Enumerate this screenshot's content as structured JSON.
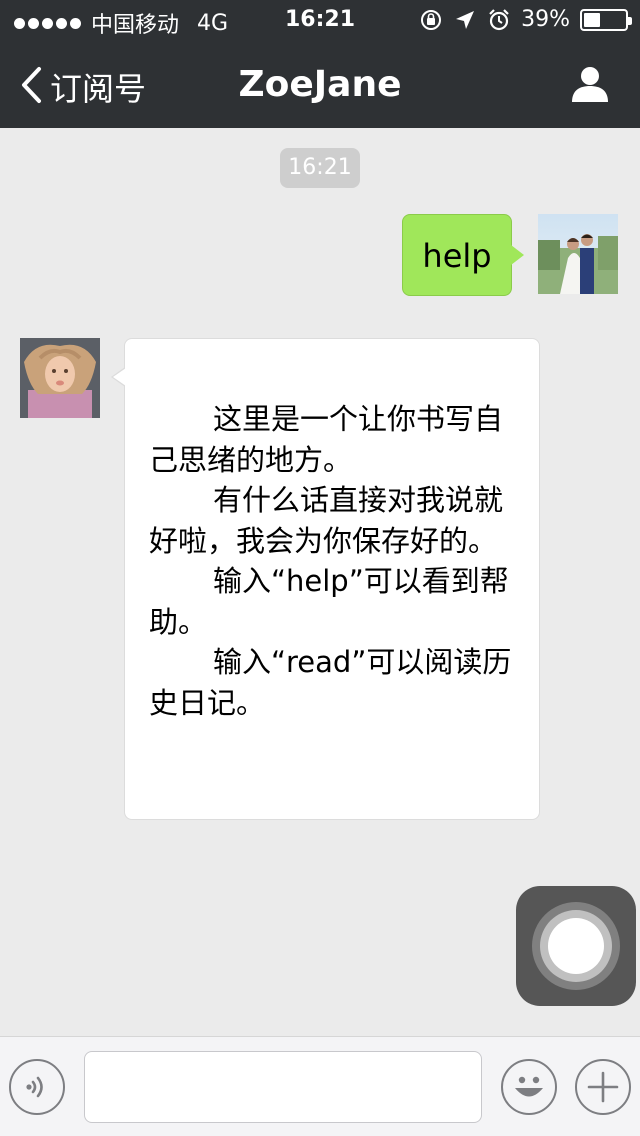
{
  "status_bar": {
    "carrier": "中国移动",
    "network": "4G",
    "time": "16:21",
    "battery_percent_label": "39%",
    "battery_level": 0.39,
    "icons": [
      "signal-dots-icon",
      "rotation-lock-icon",
      "location-arrow-icon",
      "alarm-clock-icon",
      "battery-icon"
    ]
  },
  "nav": {
    "back_label": "订阅号",
    "title": "ZoeJane",
    "icons": [
      "back-chevron-icon",
      "person-icon"
    ]
  },
  "chat": {
    "timestamp": "16:21",
    "messages": [
      {
        "from": "me",
        "text": "help"
      },
      {
        "from": "account",
        "paragraphs": [
          "这里是一个让你书写自己思绪的地方。",
          "有什么话直接对我说就好啦，我会为你保存好的。",
          "输入“help”可以看到帮助。",
          "输入“read”可以阅读历史日记。"
        ]
      }
    ]
  },
  "input_bar": {
    "placeholder": "",
    "icons": [
      "voice-icon",
      "emoji-icon",
      "plus-icon"
    ]
  },
  "colors": {
    "bar_bg": "#2e3134",
    "chat_bg": "#ebebeb",
    "outgoing_bubble": "#a0e75a",
    "incoming_bubble": "#ffffff"
  }
}
